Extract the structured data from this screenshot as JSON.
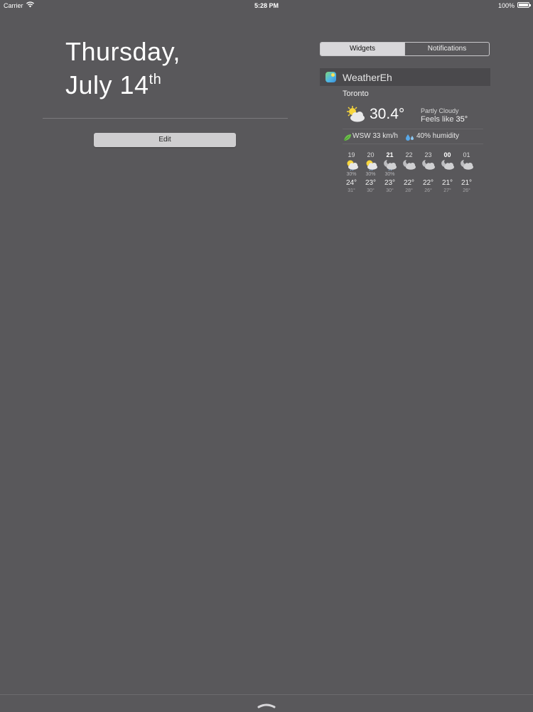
{
  "status_bar": {
    "carrier": "Carrier",
    "time": "5:28 PM",
    "battery": "100%",
    "icons": [
      "wifi-icon",
      "battery-icon"
    ]
  },
  "date_panel": {
    "weekday": "Thursday,",
    "date": "July 14",
    "date_suffix": "th",
    "edit_label": "Edit"
  },
  "segmented_control": {
    "tabs": [
      {
        "label": "Widgets",
        "selected": true
      },
      {
        "label": "Notifications",
        "selected": false
      }
    ]
  },
  "widget": {
    "title": "WeatherEh",
    "icon": "weathereh-app-icon",
    "city": "Toronto",
    "current": {
      "temperature": "30.4°",
      "condition": "Partly Cloudy",
      "feels_like_label": "Feels like",
      "feels_like_value": "35°",
      "icon": "partly-cloudy-icon"
    },
    "wind": "WSW 33 km/h",
    "humidity": "40% humidity",
    "hourly": [
      {
        "hour": "19",
        "pop": "30%",
        "temp": "24°",
        "feels": "31°",
        "icon": "sun-cloud-rain-icon",
        "bold": false
      },
      {
        "hour": "20",
        "pop": "30%",
        "temp": "23°",
        "feels": "30°",
        "icon": "sun-cloud-rain-icon",
        "bold": false
      },
      {
        "hour": "21",
        "pop": "30%",
        "temp": "23°",
        "feels": "30°",
        "icon": "moon-cloud-rain-icon",
        "bold": true
      },
      {
        "hour": "22",
        "pop": "",
        "temp": "22°",
        "feels": "28°",
        "icon": "moon-cloud-icon",
        "bold": false
      },
      {
        "hour": "23",
        "pop": "",
        "temp": "22°",
        "feels": "26°",
        "icon": "moon-cloud-icon",
        "bold": false
      },
      {
        "hour": "00",
        "pop": "",
        "temp": "21°",
        "feels": "27°",
        "icon": "moon-cloud-icon",
        "bold": true
      },
      {
        "hour": "01",
        "pop": "",
        "temp": "21°",
        "feels": "26°",
        "icon": "moon-cloud-icon",
        "bold": false
      }
    ]
  },
  "colors": {
    "background": "#59585b",
    "widget_header": "#4a494c",
    "segment_selected": "#d8d7da"
  }
}
